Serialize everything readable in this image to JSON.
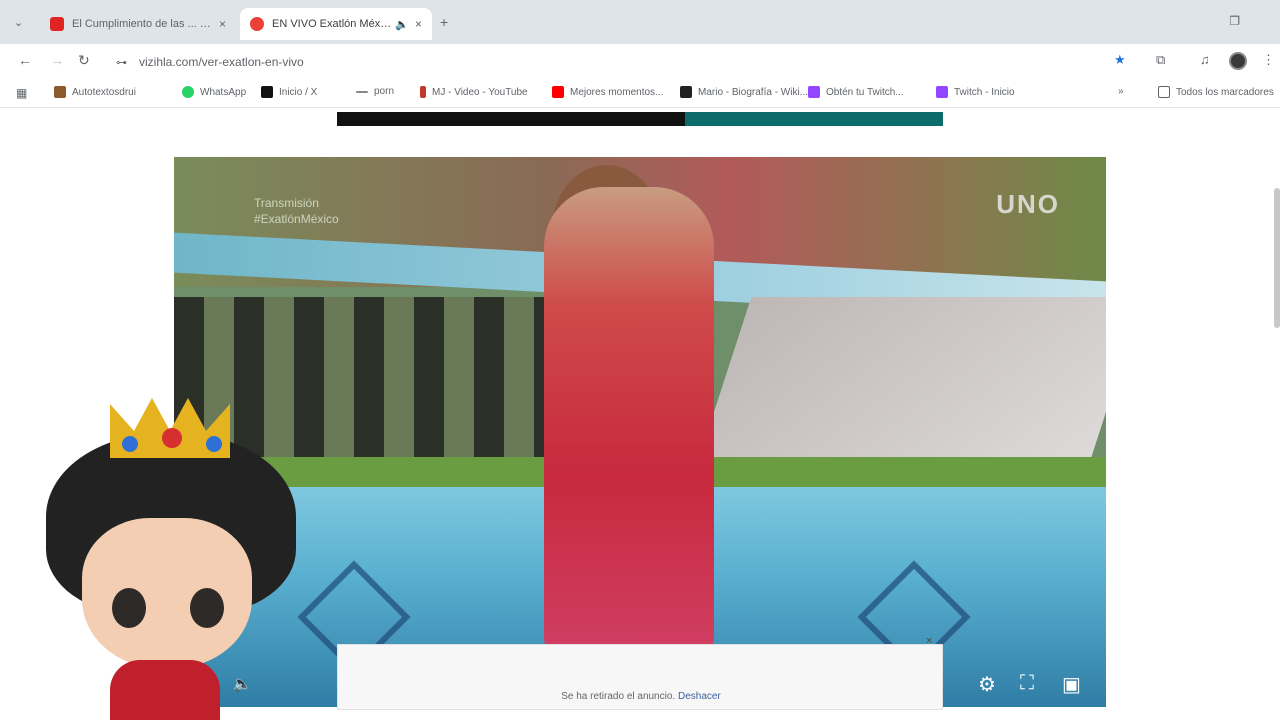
{
  "browser": {
    "tabs": [
      {
        "label": "El Cumplimiento de las ... #dhinson...",
        "favicon_color": "#e02424"
      },
      {
        "label": "EN VIVO Exatlón México",
        "favicon_color": "#ea4335"
      }
    ],
    "url": "vizihla.com/ver-exatlon-en-vivo",
    "bookmarks": [
      {
        "label": "Autotextosdrui",
        "color": "#8a5a2a"
      },
      {
        "label": "WhatsApp",
        "color": "#25d366"
      },
      {
        "label": "Inicio / X",
        "color": "#111111"
      },
      {
        "label": "porn",
        "color": "#888888"
      },
      {
        "label": "MJ - Video - YouTube",
        "color": "#c0392b"
      },
      {
        "label": "Mejores momentos...",
        "color": "#ff0000"
      },
      {
        "label": "Mario - Biografía - Wiki...",
        "color": "#222222"
      },
      {
        "label": "Obtén tu Twitch...",
        "color": "#9146ff"
      },
      {
        "label": "Twitch - Inicio",
        "color": "#9146ff"
      },
      {
        "label": "Todos los marcadores",
        "color": "#5f6368"
      }
    ]
  },
  "video": {
    "overlay_text_line1": "Transmisión",
    "overlay_text_line2": "#ExatlónMéxico",
    "channel_logo": "UNO"
  },
  "ad": {
    "text": "Se ha retirado el anuncio.",
    "link": "Deshacer",
    "close": "×"
  }
}
